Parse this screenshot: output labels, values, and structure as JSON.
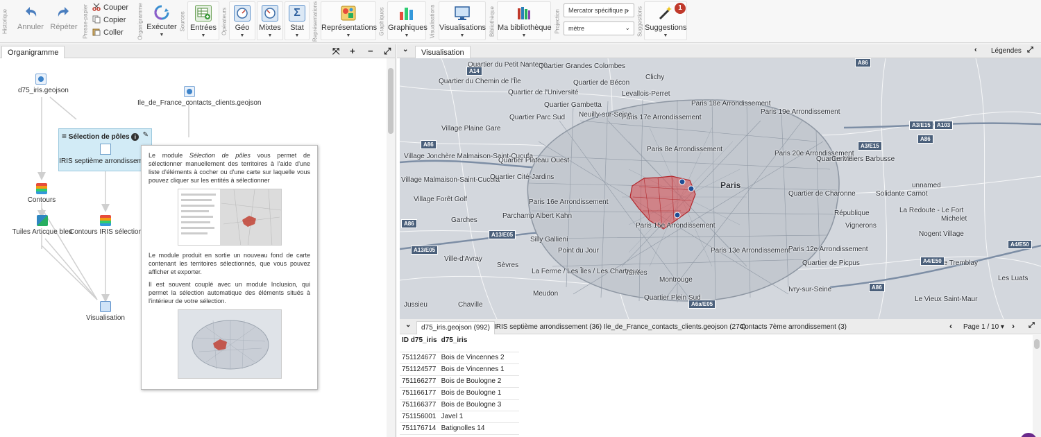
{
  "toolbar": {
    "groups": {
      "historique": "Historique",
      "presse_papier": "Presse-papier",
      "organigramme": "Organigramme",
      "sources": "Sources",
      "operateurs": "Opérateurs",
      "representations": "Représentations",
      "graphiques": "Graphiques",
      "visualisations": "Visualisations",
      "bibliotheque": "Bibliothèque",
      "projection": "Projection",
      "suggestions": "Suggestions"
    },
    "undo_label": "Annuler",
    "redo_label": "Répéter",
    "cut_label": "Couper",
    "copy_label": "Copier",
    "paste_label": "Coller",
    "execute_label": "Exécuter",
    "inputs_label": "Entrées",
    "geo_label": "Géo",
    "mixed_label": "Mixtes",
    "stat_label": "Stat",
    "representations_label": "Représentations",
    "charts_label": "Graphiques",
    "visualizations_label": "Visualisations",
    "library_label": "Ma bibliothèque",
    "projection_value": "Mercator spécifique p",
    "unit_value": "mètre",
    "suggestions_label": "Suggestions",
    "suggestions_count": "1"
  },
  "left_panel": {
    "tab_label": "Organigramme",
    "controls": {
      "fit": "⤧",
      "zoom_in": "+",
      "zoom_out": "−",
      "expand": "⤢"
    },
    "nodes": {
      "d75": "d75_iris.geojson",
      "contacts": "Ile_de_France_contacts_clients.geojson",
      "contours": "Contours",
      "tuiles": "Tuiles Articque bleu",
      "contours_iris": "Contours IRIS sélectionnés",
      "visualisation": "Visualisation"
    },
    "module": {
      "title": "Sélection de pôles",
      "subtitle": "IRIS septième arrondissement"
    },
    "help": {
      "p1_pre": "Le module ",
      "p1_em": "Sélection de pôles",
      "p1_post": " vous permet de sélectionner manuellement des territoires à l'aide d'une liste d'éléments à cocher ou d'une carte sur laquelle vous pouvez cliquer sur les entités à sélectionner",
      "p2": "Le module produit en sortie un nouveau fond de carte contenant les territoires sélectionnés, que vous pouvez afficher et exporter.",
      "p3": "Il est souvent couplé avec un module Inclusion, qui permet la sélection automatique des éléments situés à l'intérieur de votre sélection."
    }
  },
  "right_panel": {
    "tab_label": "Visualisation",
    "legend_label": "Légendes",
    "map_labels": {
      "paris": "Paris",
      "arr12": "Paris 12e Arrondissement",
      "arr15": "Paris 15e Arrondissement",
      "arr16": "Paris 16e Arrondissement",
      "arr13": "Paris 13e Arrondissement",
      "arr17": "Paris 17e Arrondissement",
      "arr18": "Paris 18e Arrondissement",
      "arr19": "Paris 19e Arrondissement",
      "arr20": "Paris 20e Arrondissement",
      "arr8": "Paris 8e Arrondissement",
      "levallois": "Levallois-Perret",
      "neuilly": "Neuilly-sur-Seine",
      "clichy": "Clichy",
      "montreuil": "Quartier Villiers Barbusse",
      "garches": "Garches",
      "sevres": "Sèvres",
      "chaville": "Chaville",
      "meudon": "Meudon",
      "vanves": "Vanves",
      "montrouge": "Montrouge",
      "ivry": "Ivry-sur-Seine",
      "parchamp": "Parchamp Albert Kahn",
      "jussieu": "Jussieu",
      "ville_avray": "Ville-d'Avray",
      "foret_golf": "Village Forêt Golf",
      "plaine_gare": "Village Plaine Gare",
      "jonchere": "Village Jonchère Malmaison-Saint-Cucufa",
      "st_cucufa": "Village Malmaison-Saint-Cucufa",
      "parc_sud": "Quartier Parc Sud",
      "gambetta": "Quartier Gambetta",
      "becon": "Quartier de Bécon",
      "universite": "Quartier de l'Université",
      "chemin_ile": "Quartier du Chemin de l'Île",
      "petit_nanterre": "Quartier du Petit Nanterre",
      "colombes": "Quartier Grandes Colombes",
      "plateau_ouest": "Quartier Plateau Ouest",
      "cite_jardins": "Quartier Cité-Jardins",
      "point_jour": "Point du Jour",
      "silly": "Silly Gallieni",
      "ferme_iles": "La Ferme / Les Îles / Les Chartreux",
      "plein_sud": "Quartier Plein Sud",
      "picpus": "Quartier de Picpus",
      "republique": "République",
      "vignerons": "Vignerons",
      "solidante": "Solidante Carnot",
      "unnamed": "unnamed",
      "redoute": "La Redoute - Le Fort",
      "michelet": "Michelet",
      "nogent": "Nogent Village",
      "tremblay": "Le Tremblay",
      "luats": "Les Luats",
      "vieux_st_maur": "Le Vieux Saint-Maur",
      "charonne": "Quartier de Charonne",
      "centre": "Centre"
    },
    "roads": [
      "A14",
      "A86",
      "A86",
      "A3/E15",
      "A103",
      "A3/E15",
      "A86",
      "A13/E05",
      "A13/E05",
      "A86",
      "A4/E50",
      "A4/E50",
      "A86",
      "A6a/E05"
    ],
    "table_tabs": [
      "d75_iris.geojson (992)",
      "IRIS septième arrondissement (36)",
      "Ile_de_France_contacts_clients.geojson (274)",
      "Contacts 7ème arrondissement (3)"
    ],
    "pagination": "Page 1 / 10",
    "columns": [
      "ID d75_iris",
      "d75_iris"
    ],
    "rows": [
      [
        "751124677",
        "Bois de Vincennes 2"
      ],
      [
        "751124577",
        "Bois de Vincennes 1"
      ],
      [
        "751166277",
        "Bois de Boulogne 2"
      ],
      [
        "751166177",
        "Bois de Boulogne 1"
      ],
      [
        "751166377",
        "Bois de Boulogne 3"
      ],
      [
        "751156001",
        "Javel 1"
      ],
      [
        "751176714",
        "Batignolles 14"
      ]
    ]
  }
}
